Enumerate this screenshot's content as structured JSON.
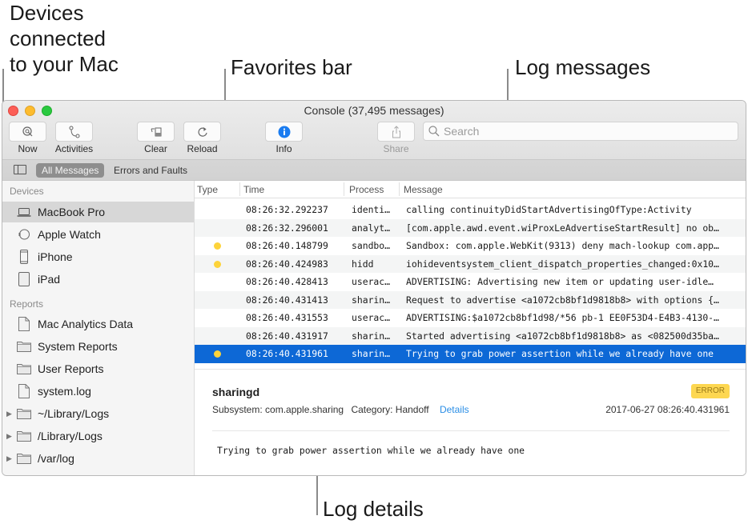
{
  "callouts": {
    "devices": [
      "Devices",
      "connected",
      "to your Mac"
    ],
    "favorites": "Favorites bar",
    "log_messages": "Log messages",
    "log_details": "Log details"
  },
  "window": {
    "title": "Console (37,495 messages)"
  },
  "toolbar": {
    "now": "Now",
    "activities": "Activities",
    "clear": "Clear",
    "reload": "Reload",
    "info": "Info",
    "share": "Share",
    "search_placeholder": "Search"
  },
  "favorites_bar": {
    "items": [
      "All Messages",
      "Errors and Faults"
    ],
    "active": "All Messages"
  },
  "sidebar": {
    "devices_header": "Devices",
    "devices": [
      {
        "label": "MacBook Pro",
        "icon": "laptop-icon",
        "selected": true
      },
      {
        "label": "Apple Watch",
        "icon": "watch-icon"
      },
      {
        "label": "iPhone",
        "icon": "iphone-icon"
      },
      {
        "label": "iPad",
        "icon": "ipad-icon"
      }
    ],
    "reports_header": "Reports",
    "reports": [
      {
        "label": "Mac Analytics Data",
        "icon": "document-icon"
      },
      {
        "label": "System Reports",
        "icon": "folder-icon"
      },
      {
        "label": "User Reports",
        "icon": "folder-icon"
      },
      {
        "label": "system.log",
        "icon": "document-icon"
      },
      {
        "label": "~/Library/Logs",
        "icon": "folder-icon",
        "expandable": true
      },
      {
        "label": "/Library/Logs",
        "icon": "folder-icon",
        "expandable": true
      },
      {
        "label": "/var/log",
        "icon": "folder-icon",
        "expandable": true
      }
    ]
  },
  "log_table": {
    "columns": [
      "Type",
      "Time",
      "Process",
      "Message"
    ],
    "rows": [
      {
        "type": "",
        "time": "08:26:32.292237",
        "process": "identi…",
        "message": "calling continuityDidStartAdvertisingOfType:Activity"
      },
      {
        "type": "",
        "time": "08:26:32.296001",
        "process": "analyt…",
        "message": "[com.apple.awd.event.wiProxLeAdvertiseStartResult] no ob…"
      },
      {
        "type": "error",
        "time": "08:26:40.148799",
        "process": "sandbo…",
        "message": "Sandbox: com.apple.WebKit(9313) deny mach-lookup com.app…"
      },
      {
        "type": "error",
        "time": "08:26:40.424983",
        "process": "hidd",
        "message": "iohideventsystem_client_dispatch_properties_changed:0x10…"
      },
      {
        "type": "",
        "time": "08:26:40.428413",
        "process": "userac…",
        "message": "ADVERTISING: Advertising new item or updating user-idle…"
      },
      {
        "type": "",
        "time": "08:26:40.431413",
        "process": "sharin…",
        "message": "Request to advertise <a1072cb8bf1d9818b8> with options {…"
      },
      {
        "type": "",
        "time": "08:26:40.431553",
        "process": "userac…",
        "message": "ADVERTISING:$a1072cb8bf1d98/*56 pb-1 EE0F53D4-E4B3-4130-…"
      },
      {
        "type": "",
        "time": "08:26:40.431917",
        "process": "sharin…",
        "message": "Started advertising <a1072cb8bf1d9818b8> as <082500d35ba…"
      },
      {
        "type": "error",
        "time": "08:26:40.431961",
        "process": "sharin…",
        "message": "Trying to grab power assertion while we already have one",
        "selected": true
      }
    ]
  },
  "details": {
    "process": "sharingd",
    "badge": "ERROR",
    "subsystem": "Subsystem: com.apple.sharing",
    "category": "Category: Handoff",
    "details_link": "Details",
    "timestamp": "2017-06-27 08:26:40.431961",
    "message": "Trying to grab power assertion while we already have one"
  },
  "colors": {
    "selection": "#0d68d6",
    "error_dot": "#fdd33a",
    "badge_bg": "#fdd751",
    "link": "#2a8ee6"
  }
}
